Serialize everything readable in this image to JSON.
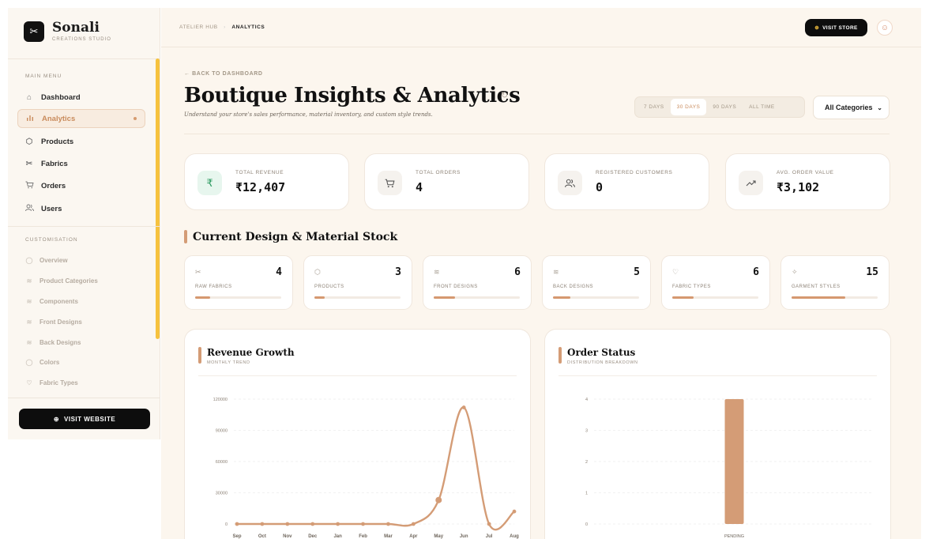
{
  "brand": {
    "name": "Sonali",
    "subtitle": "CREATIONS STUDIO",
    "icon": "scissors-icon"
  },
  "sidebar": {
    "main_menu_title": "MAIN MENU",
    "items": [
      {
        "label": "Dashboard",
        "icon": "home-icon"
      },
      {
        "label": "Analytics",
        "icon": "bar-chart-icon",
        "active": true
      },
      {
        "label": "Products",
        "icon": "box-icon"
      },
      {
        "label": "Fabrics",
        "icon": "scissors-icon"
      },
      {
        "label": "Orders",
        "icon": "cart-icon"
      },
      {
        "label": "Users",
        "icon": "users-icon"
      }
    ],
    "customisation_title": "CUSTOMISATION",
    "customisation": [
      {
        "label": "Overview"
      },
      {
        "label": "Product Categories"
      },
      {
        "label": "Components"
      },
      {
        "label": "Front Designs"
      },
      {
        "label": "Back Designs"
      },
      {
        "label": "Colors"
      },
      {
        "label": "Fabric Types"
      }
    ],
    "visit_website": "VISIT WEBSITE"
  },
  "topbar": {
    "breadcrumb_root": "ATELIER HUB",
    "breadcrumb_current": "ANALYTICS",
    "visit_store": "VISIT STORE"
  },
  "header": {
    "back": "← BACK TO DASHBOARD",
    "title": "Boutique Insights & Analytics",
    "subtitle": "Understand your store's sales performance, material inventory, and custom style trends."
  },
  "range": {
    "options": [
      "7 DAYS",
      "30 DAYS",
      "90 DAYS",
      "ALL TIME"
    ],
    "selected": "30 DAYS"
  },
  "category_select": {
    "value": "All Categories"
  },
  "stats": [
    {
      "label": "TOTAL REVENUE",
      "value": "₹12,407",
      "icon": "rupee-icon",
      "bg": "#e7f6ee",
      "fg": "#2e9b62"
    },
    {
      "label": "TOTAL ORDERS",
      "value": "4",
      "icon": "cart-icon",
      "bg": "#f5f2ee",
      "fg": "#555555"
    },
    {
      "label": "REGISTERED CUSTOMERS",
      "value": "0",
      "icon": "users-icon",
      "bg": "#f5f2ee",
      "fg": "#555555"
    },
    {
      "label": "AVG. ORDER VALUE",
      "value": "₹3,102",
      "icon": "trend-up-icon",
      "bg": "#f5f2ee",
      "fg": "#555555"
    }
  ],
  "stock": {
    "title": "Current Design & Material Stock",
    "items": [
      {
        "label": "RAW FABRICS",
        "value": "4",
        "icon": "scissors-icon",
        "fill": 0.17
      },
      {
        "label": "PRODUCTS",
        "value": "3",
        "icon": "box-icon",
        "fill": 0.12
      },
      {
        "label": "FRONT DESIGNS",
        "value": "6",
        "icon": "layers-icon",
        "fill": 0.25
      },
      {
        "label": "BACK DESIGNS",
        "value": "5",
        "icon": "layers-icon",
        "fill": 0.2
      },
      {
        "label": "FABRIC TYPES",
        "value": "6",
        "icon": "shirt-icon",
        "fill": 0.25
      },
      {
        "label": "GARMENT STYLES",
        "value": "15",
        "icon": "sparkle-icon",
        "fill": 0.62
      }
    ]
  },
  "revenue_chart": {
    "title": "Revenue Growth",
    "subtitle": "MONTHLY TREND"
  },
  "status_chart": {
    "title": "Order Status",
    "subtitle": "DISTRIBUTION BREAKDOWN"
  },
  "chart_data": [
    {
      "type": "line",
      "title": "Revenue Growth",
      "x": [
        "Sep",
        "Oct",
        "Nov",
        "Dec",
        "Jan",
        "Feb",
        "Mar",
        "Apr",
        "May",
        "Jun",
        "Jul",
        "Aug"
      ],
      "values": [
        0,
        0,
        0,
        0,
        0,
        0,
        0,
        0,
        23000,
        112000,
        0,
        12000
      ],
      "yticks": [
        0,
        30000,
        60000,
        90000,
        120000
      ],
      "ylim": [
        0,
        120000
      ],
      "grid": true,
      "color": "#d49c76"
    },
    {
      "type": "bar",
      "title": "Order Status",
      "categories": [
        "PENDING"
      ],
      "values": [
        4
      ],
      "yticks": [
        0,
        1,
        2,
        3,
        4
      ],
      "ylim": [
        0,
        4
      ],
      "grid": true,
      "color": "#d49c76"
    }
  ]
}
